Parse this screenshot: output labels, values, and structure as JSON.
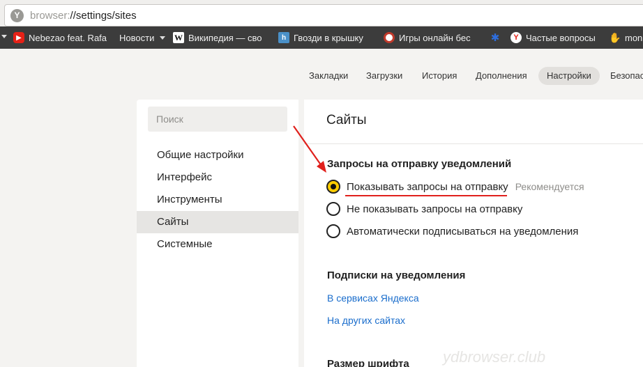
{
  "address_bar": {
    "scheme": "browser:",
    "path": "//settings/sites",
    "icon": "yandex-browser-icon"
  },
  "bookmarks": [
    {
      "label": "Nebezao feat. Rafa",
      "icon": "youtube-icon",
      "color": "#e62117"
    },
    {
      "label": "Новости",
      "icon": "dropdown-folder"
    },
    {
      "label": "Википедия — сво",
      "icon": "wikipedia-icon",
      "color": "#ffffff"
    },
    {
      "label": "Гвозди в крышку",
      "icon": "h-site-icon",
      "color": "#4a90c8"
    },
    {
      "label": "Игры онлайн бес",
      "icon": "games-icon",
      "color": "#c0392b"
    },
    {
      "label": "",
      "icon": "puzzle-icon",
      "color": "#2d6ee0"
    },
    {
      "label": "Частые вопросы",
      "icon": "yandex-icon",
      "color": "#ffffff"
    },
    {
      "label": "mon",
      "icon": "hand-icon",
      "color": "#f2c12e"
    }
  ],
  "top_nav": [
    "Закладки",
    "Загрузки",
    "История",
    "Дополнения",
    "Настройки",
    "Безопас"
  ],
  "sidebar": {
    "search_placeholder": "Поиск",
    "items": [
      "Общие настройки",
      "Интерфейс",
      "Инструменты",
      "Сайты",
      "Системные"
    ]
  },
  "main": {
    "title": "Сайты",
    "notifications": {
      "title": "Запросы на отправку уведомлений",
      "options": [
        {
          "label": "Показывать запросы на отправку",
          "hint": "Рекомендуется",
          "checked": true
        },
        {
          "label": "Не показывать запросы на отправку",
          "hint": "",
          "checked": false
        },
        {
          "label": "Автоматически подписываться на уведомления",
          "hint": "",
          "checked": false
        }
      ]
    },
    "subscriptions": {
      "title": "Подписки на уведомления",
      "links": [
        "В сервисах Яндекса",
        "На других сайтах"
      ]
    },
    "font_size_title": "Размер шрифта"
  },
  "watermark": "ydbrowser.club",
  "colors": {
    "accent_radio": "#ffcc00",
    "link": "#1a6dcc",
    "annotation_red": "#e0201c"
  }
}
